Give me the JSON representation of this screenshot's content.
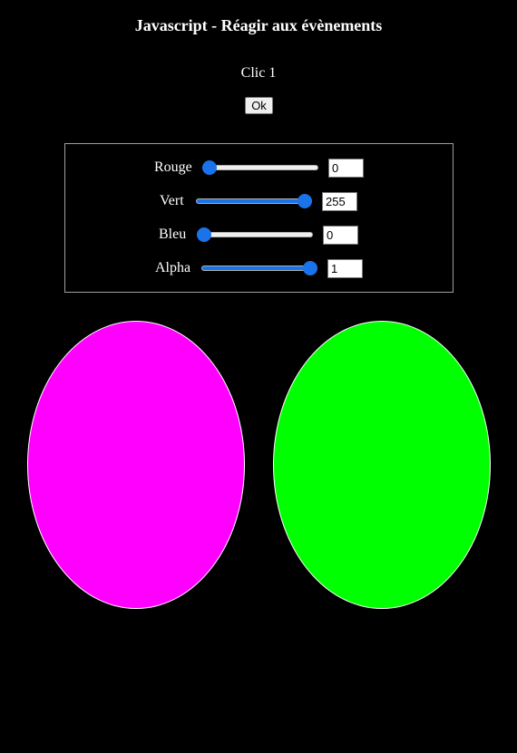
{
  "page": {
    "title": "Javascript - Réagir aux évènements",
    "click_text": "Clic 1",
    "ok_label": "Ok"
  },
  "controls": [
    {
      "label": "Rouge",
      "value": "0",
      "min": 0,
      "max": 255
    },
    {
      "label": "Vert",
      "value": "255",
      "min": 0,
      "max": 255
    },
    {
      "label": "Bleu",
      "value": "0",
      "min": 0,
      "max": 255
    },
    {
      "label": "Alpha",
      "value": "1",
      "min": 0,
      "max": 1
    }
  ],
  "shapes": [
    {
      "name": "magenta-ellipse",
      "color": "#ff00ff"
    },
    {
      "name": "green-ellipse",
      "color": "#00ff00"
    }
  ],
  "colors": {
    "background": "#000000",
    "slider_accent": "#1a73e8"
  }
}
